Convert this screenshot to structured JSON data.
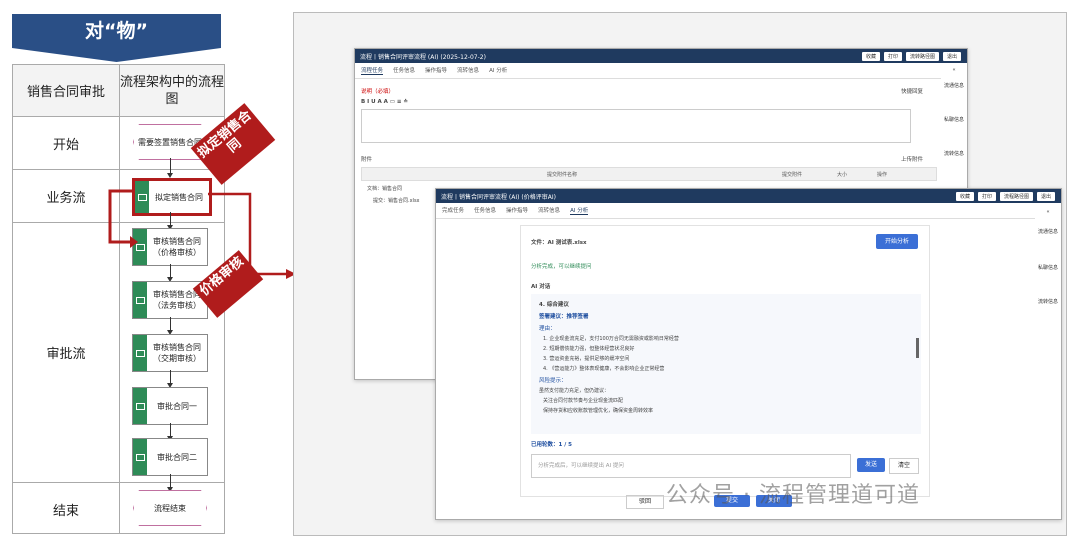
{
  "banner": {
    "title": "对“物”"
  },
  "table": {
    "col1": "销售合同审批",
    "col2": "流程架构中的流程图",
    "rows": [
      "开始",
      "业务流",
      "审批流",
      "结束"
    ]
  },
  "flow": {
    "start": "需要签置销售合同",
    "t1": "拟定销售合同",
    "t2": "审核销售合同（价格审核）",
    "t3": "审核销售合同（法务审核）",
    "t4": "审核销售合同（交期审核）",
    "t5": "审批合同一",
    "t6": "审批合同二",
    "end": "流程结束"
  },
  "tags": {
    "a": "拟定销售合同",
    "b": "价格审核"
  },
  "win1": {
    "title": "流程丨销售合同评审流程 (AI)   (2025-12-07-2)",
    "btns": [
      "收藏",
      "打印",
      "流转路径图",
      "退出"
    ],
    "tabs": [
      "流程任务",
      "任务信息",
      "操作指导",
      "流转信息",
      "AI 分析"
    ],
    "desc_label": "说明（必填）",
    "quick": "快捷回复",
    "toolbar": "B I U A A ▭ ≡ ≐",
    "attach_label": "附件",
    "upload": "上传附件",
    "cols": [
      "提交附件名称",
      "提交附件",
      "大小",
      "操作"
    ],
    "file_row": "文档：销售合同",
    "file_row2": "提交：销售合同.xlsx",
    "side": [
      "流通信息",
      "私聊信息",
      "流转信息"
    ]
  },
  "win2": {
    "title": "流程丨销售合同评审流程 (AI)   (价格评审AI)",
    "btns": [
      "收藏",
      "打印",
      "流程路径图",
      "退出"
    ],
    "tabs": [
      "完成任务",
      "任务信息",
      "操作指导",
      "流转信息",
      "AI 分析"
    ],
    "file": "文件：AI 测试表.xlsx",
    "start_btn": "开始分析",
    "status": "分析完成，可以继续提问",
    "ai_title": "AI 对话",
    "s1": "4. 综合建议",
    "s2": "签署建议：推荐签署",
    "s3": "理由：",
    "reasons": [
      "1. 企业现金流充足，支付100万合同无需融资或影响日常经营",
      "2. 短期偿债能力强，但整体经营状况良好",
      "3. 营运资金充裕，提供足够的缓冲空间",
      "4. 《营运能力》整体表现健康，不会影响企业正常经营"
    ],
    "risk": "风险提示：",
    "risk_intro": "虽然支付能力充足，但仍建议：",
    "risks": [
      "关注合同付款节奏与企业现金流匹配",
      "保持存货和应收账款管理优化，确保资金周转效率"
    ],
    "count": "已用轮数：1 / 5",
    "input_ph": "分析完成后，可以继续提出 AI 提问",
    "send": "发送",
    "clear": "清空",
    "side": [
      "流通信息",
      "私聊信息",
      "流转信息"
    ],
    "footer": [
      "驳回",
      "提交",
      "关闭"
    ]
  },
  "watermark": "公众号 · 流程管理道可道"
}
